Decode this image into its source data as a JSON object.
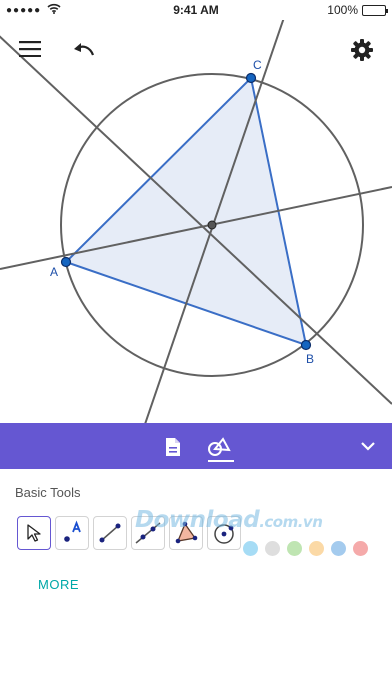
{
  "status_bar": {
    "signal_dots": "●●●●●",
    "time": "9:41 AM",
    "battery_percent": "100%",
    "battery_level": 1.0
  },
  "toolbar": {
    "menu_icon": "hamburger-icon",
    "undo_icon": "undo-icon",
    "settings_icon": "gear-icon"
  },
  "construction": {
    "points": [
      {
        "label": "A"
      },
      {
        "label": "B"
      },
      {
        "label": "C"
      }
    ]
  },
  "tool_header": {
    "tabs": [
      "algebra-icon",
      "tools-icon"
    ],
    "active_tab": "tools-icon",
    "collapse_icon": "chevron-down-icon"
  },
  "tools_panel": {
    "section_title": "Basic Tools",
    "tools": [
      "move",
      "point",
      "segment",
      "line",
      "polygon",
      "circle-center-point"
    ],
    "selected_tool": "move",
    "more_label": "MORE"
  },
  "watermark": {
    "main": "Download",
    "tld": ".com.vn"
  },
  "colors": {
    "accent": "#6557d2",
    "point_fill": "#1565c0",
    "polygon_fill": "#e3eaf6",
    "polygon_stroke": "#3a6ec6",
    "line": "#616161",
    "more_text": "#00a8a8",
    "palette": [
      "#a6dcf5",
      "#dedede",
      "#bfe5b2",
      "#fbd9a6",
      "#a4cbee",
      "#f5aaaa"
    ]
  }
}
